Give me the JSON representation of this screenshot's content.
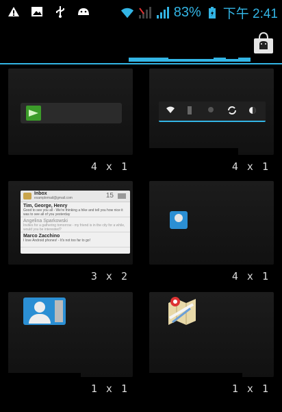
{
  "status_bar": {
    "icons_left": [
      "warning-icon",
      "image-icon",
      "usb-icon",
      "android-icon"
    ],
    "icons_right": [
      "wifi-icon",
      "signal-icon",
      "signal-icon",
      "battery-icon"
    ],
    "battery_percent": "83%",
    "clock": "下午 2:41"
  },
  "accent_color": "#33b5e5",
  "widgets": [
    {
      "size": "4 x 1"
    },
    {
      "size": "4 x 1"
    },
    {
      "size": "3 x 2",
      "gmail": {
        "title": "Inbox",
        "account": "examplemail@gmail.com",
        "count": "15",
        "messages": [
          {
            "from": "Tim, George, Henry",
            "body": "Good to see you all - We're thinking a hike and tell you how nice it was to see all of you yesterday"
          },
          {
            "from": "Angelina Sparkowski",
            "body": "Invites for a gathering tomorrow - my friend is in the city for a while, would you be interested?"
          },
          {
            "from": "Marco Zacchino",
            "body": "I love Android phones! - It's not too far to go!"
          }
        ]
      }
    },
    {
      "size": "4 x 1"
    },
    {
      "size": "1 x 1"
    },
    {
      "size": "1 x 1"
    }
  ]
}
